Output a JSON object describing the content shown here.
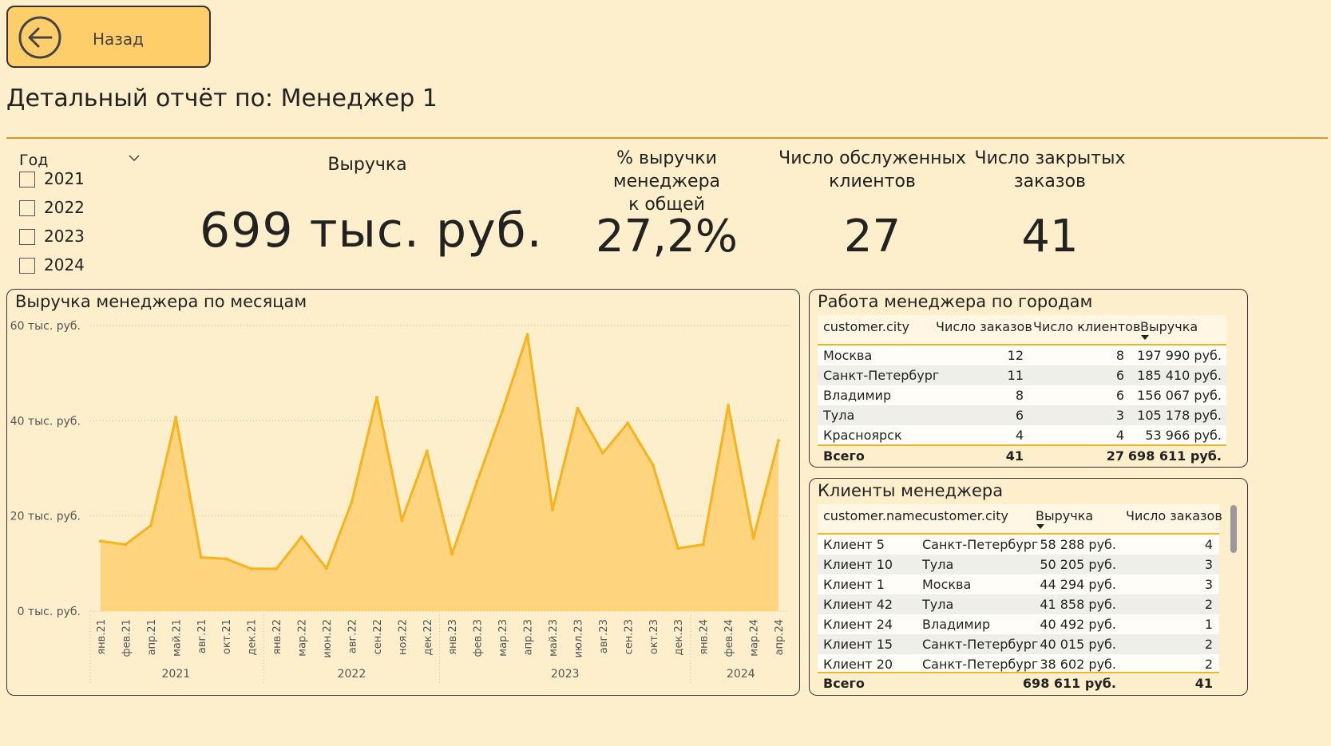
{
  "back_button": {
    "label": "Назад"
  },
  "page": {
    "title": "Детальный отчёт по: Менеджер 1"
  },
  "slicer": {
    "title": "Год",
    "options": [
      "2021",
      "2022",
      "2023",
      "2024"
    ]
  },
  "kpis": {
    "revenue": {
      "title": "Выручка",
      "value": "699 тыс.  руб."
    },
    "share": {
      "title_line1": "% выручки менеджера",
      "title_line2": "к общей",
      "value": "27,2%"
    },
    "clients": {
      "title_line1": "Число обслуженных",
      "title_line2": "клиентов",
      "value": "27"
    },
    "orders": {
      "title_line1": "Число закрытых",
      "title_line2": "заказов",
      "value": "41"
    }
  },
  "chart_panel": {
    "title": "Выручка менеджера по месяцам"
  },
  "chart_data": {
    "type": "area",
    "title": "Выручка менеджера по месяцам",
    "xlabel": "",
    "ylabel": "",
    "ylim": [
      0,
      60
    ],
    "y_ticks": [
      "0 тыс. руб.",
      "20 тыс. руб.",
      "40 тыс. руб.",
      "60 тыс. руб."
    ],
    "grid": true,
    "color": "#f7b21c",
    "fill_color": "#ffd47e",
    "x_tick_labels": [
      "янв.21",
      "фев.21",
      "апр.21",
      "май.21",
      "авг.21",
      "окт.21",
      "дек.21",
      "янв.22",
      "мар.22",
      "июн.22",
      "авг.22",
      "сен.22",
      "ноя.22",
      "дек.22",
      "янв.23",
      "фев.23",
      "мар.23",
      "апр.23",
      "май.23",
      "июл.23",
      "авг.23",
      "сен.23",
      "окт.23",
      "дек.23",
      "янв.24",
      "фев.24",
      "мар.24",
      "апр.24"
    ],
    "year_groups": [
      {
        "label": "2021",
        "start": 0,
        "end": 6
      },
      {
        "label": "2022",
        "start": 7,
        "end": 13
      },
      {
        "label": "2023",
        "start": 14,
        "end": 23
      },
      {
        "label": "2024",
        "start": 24,
        "end": 27
      }
    ],
    "values": [
      14.7,
      14.0,
      18.0,
      40.7,
      11.3,
      11.0,
      8.9,
      8.9,
      15.6,
      9.0,
      22.9,
      44.9,
      19.1,
      33.6,
      12.0,
      27.3,
      42.0,
      58.1,
      21.3,
      42.6,
      33.2,
      39.5,
      30.7,
      13.2,
      14.0,
      43.2,
      15.3,
      35.8
    ]
  },
  "cities_panel": {
    "title": "Работа менеджера по городам",
    "columns": [
      "customer.city",
      "Число заказов",
      "Число клиентов",
      "Выручка"
    ],
    "rows": [
      [
        "Москва",
        "12",
        "8",
        "197 990 руб."
      ],
      [
        "Санкт-Петербург",
        "11",
        "6",
        "185 410 руб."
      ],
      [
        "Владимир",
        "8",
        "6",
        "156 067 руб."
      ],
      [
        "Тула",
        "6",
        "3",
        "105 178 руб."
      ],
      [
        "Красноярск",
        "4",
        "4",
        "53 966 руб."
      ]
    ],
    "total": [
      "Всего",
      "41",
      "27",
      "698 611 руб."
    ]
  },
  "clients_panel": {
    "title": "Клиенты менеджера",
    "columns": [
      "customer.name",
      "customer.city",
      "Выручка",
      "Число заказов"
    ],
    "rows": [
      [
        "Клиент 5",
        "Санкт-Петербург",
        "58 288 руб.",
        "4"
      ],
      [
        "Клиент 10",
        "Тула",
        "50 205 руб.",
        "3"
      ],
      [
        "Клиент 1",
        "Москва",
        "44 294 руб.",
        "3"
      ],
      [
        "Клиент 42",
        "Тула",
        "41 858 руб.",
        "2"
      ],
      [
        "Клиент 24",
        "Владимир",
        "40 492 руб.",
        "1"
      ],
      [
        "Клиент 15",
        "Санкт-Петербург",
        "40 015 руб.",
        "2"
      ],
      [
        "Клиент 20",
        "Санкт-Петербург",
        "38 602 руб.",
        "2"
      ]
    ],
    "total": [
      "Всего",
      "",
      "698 611 руб.",
      "41"
    ]
  }
}
